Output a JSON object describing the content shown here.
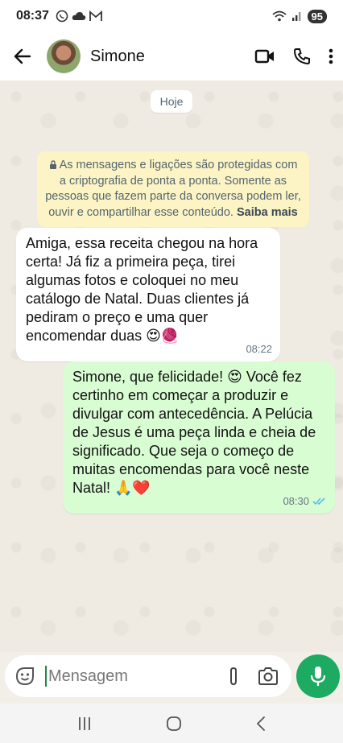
{
  "status_bar": {
    "time": "08:37",
    "battery": "95"
  },
  "header": {
    "contact_name": "Simone"
  },
  "chat": {
    "date_chip": "Hoje",
    "encryption_notice": "As mensagens e ligações são protegidas com a criptografia de ponta a ponta. Somente as pessoas que fazem parte da conversa podem ler, ouvir e compartilhar esse conteúdo.",
    "learn_more": "Saiba mais",
    "messages": [
      {
        "direction": "incoming",
        "text": "Amiga, essa receita chegou na hora certa! Já fiz a primeira peça, tirei algumas fotos e coloquei no meu catálogo de Natal. Duas clientes já pediram o preço e uma quer encomendar duas 😍🧶",
        "time": "08:22"
      },
      {
        "direction": "outgoing",
        "text": "Simone, que felicidade! 😍 Você fez certinho em começar a produzir e divulgar com antecedência. A Pelúcia de Jesus é uma peça linda e cheia de significado. Que seja o começo de muitas encomendas para você neste Natal! 🙏❤️",
        "time": "08:30",
        "status": "read"
      }
    ]
  },
  "composer": {
    "placeholder": "Mensagem"
  },
  "colors": {
    "incoming_bubble": "#ffffff",
    "outgoing_bubble": "#d9fdd3",
    "notice_bg": "#fdf4c5",
    "mic_button": "#1daa61",
    "read_ticks": "#53bdeb"
  }
}
